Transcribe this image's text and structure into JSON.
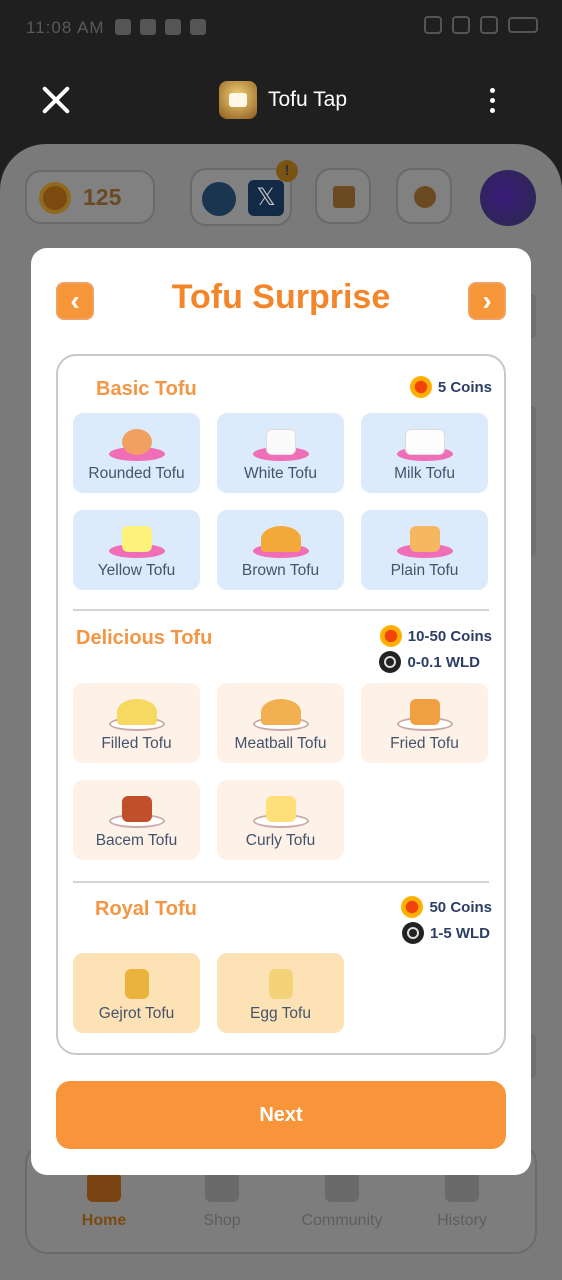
{
  "status_bar": {
    "time": "11:08 AM"
  },
  "titlebar": {
    "app_title": "Tofu Tap"
  },
  "background_app": {
    "coins": "125",
    "social_alert": "!",
    "x_label": "𝕏",
    "nav": [
      {
        "label": "Home",
        "active": true
      },
      {
        "label": "Shop"
      },
      {
        "label": "Community"
      },
      {
        "label": "History"
      }
    ]
  },
  "modal": {
    "title": "Tofu Surprise",
    "prev_icon": "‹",
    "next_icon": "›",
    "sections": [
      {
        "title": "Basic Tofu",
        "rewards": [
          "5 Coins"
        ],
        "items": [
          "Rounded Tofu",
          "White Tofu",
          "Milk Tofu",
          "Yellow Tofu",
          "Brown Tofu",
          "Plain Tofu"
        ]
      },
      {
        "title": "Delicious Tofu",
        "rewards": [
          "10-50 Coins",
          "0-0.1 WLD"
        ],
        "items": [
          "Filled Tofu",
          "Meatball Tofu",
          "Fried Tofu",
          "Bacem Tofu",
          "Curly Tofu"
        ]
      },
      {
        "title": "Royal Tofu",
        "rewards": [
          "50 Coins",
          "1-5 WLD"
        ],
        "items": [
          "Gejrot Tofu",
          "Egg Tofu"
        ]
      }
    ],
    "next_button": "Next"
  }
}
